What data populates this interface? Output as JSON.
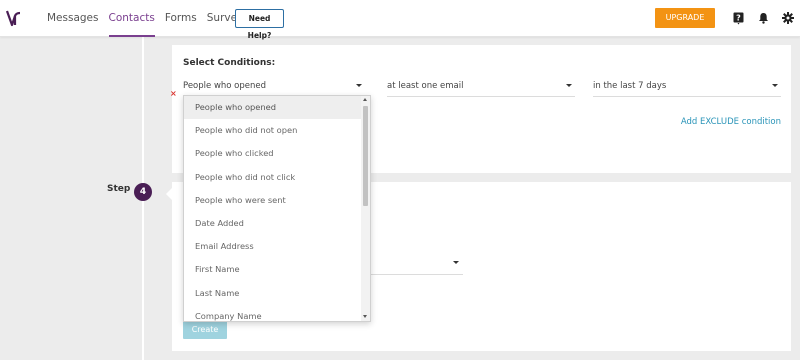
{
  "nav": {
    "items": [
      {
        "label": "Messages",
        "active": false
      },
      {
        "label": "Contacts",
        "active": true
      },
      {
        "label": "Forms",
        "active": false
      },
      {
        "label": "Surveys",
        "active": false
      }
    ],
    "help_label": "Need Help?",
    "upgrade_label": "UPGRADE"
  },
  "colors": {
    "accent": "#7a3f8f",
    "upgrade": "#f39313",
    "link": "#2a94b8",
    "step_badge": "#4a1e55"
  },
  "icons": [
    "logo-icon",
    "help-icon",
    "bell-icon",
    "gear-icon",
    "remove-icon",
    "chevron-down-icon"
  ],
  "conditions": {
    "title": "Select Conditions:",
    "who": "People who opened",
    "frequency": "at least one email",
    "timeframe": "in the last 7 days",
    "remove_mark": "×",
    "exclude_link": "Add EXCLUDE condition"
  },
  "step": {
    "label": "Step",
    "number": "4"
  },
  "create_label": "Create",
  "dropdown": {
    "options": [
      "People who opened",
      "People who did not open",
      "People who clicked",
      "People who did not click",
      "People who were sent",
      "Date Added",
      "Email Address",
      "First Name",
      "Last Name",
      "Company Name"
    ],
    "highlighted_index": 0
  }
}
